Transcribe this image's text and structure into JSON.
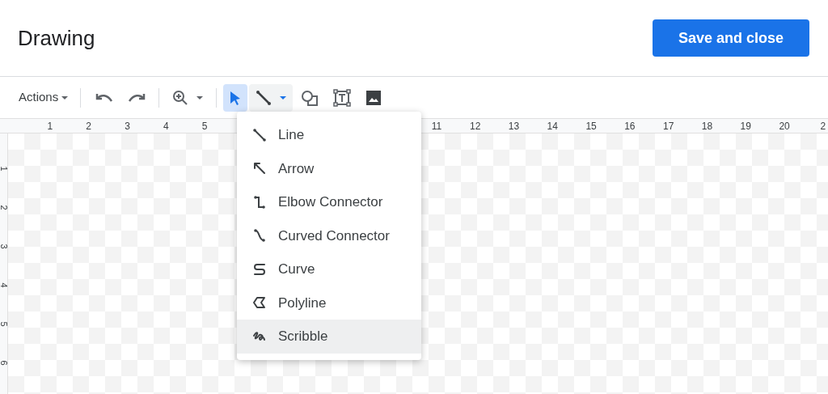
{
  "header": {
    "title": "Drawing",
    "save_button": "Save and close"
  },
  "toolbar": {
    "actions_menu": "Actions",
    "tools": [
      {
        "kind": "undo",
        "selected": false
      },
      {
        "kind": "redo",
        "selected": false
      },
      {
        "kind": "zoom",
        "selected": false
      },
      {
        "kind": "select",
        "selected": true
      },
      {
        "kind": "line",
        "selected": false,
        "expanded": true
      },
      {
        "kind": "shape",
        "selected": false
      },
      {
        "kind": "textbox",
        "selected": false
      },
      {
        "kind": "image",
        "selected": false
      }
    ]
  },
  "ruler": {
    "left_labels": [
      "1",
      "2",
      "3",
      "4",
      "5"
    ],
    "right_labels": [
      "11",
      "12",
      "13",
      "14",
      "15",
      "16",
      "17",
      "18",
      "19",
      "20",
      "2"
    ],
    "vertical_labels": [
      "1",
      "2",
      "3",
      "4",
      "5",
      "6"
    ]
  },
  "line_menu": {
    "items": [
      {
        "kind": "line",
        "label": "Line",
        "selected": false
      },
      {
        "kind": "arrow",
        "label": "Arrow",
        "selected": false
      },
      {
        "kind": "elbow",
        "label": "Elbow Connector",
        "selected": false
      },
      {
        "kind": "curved",
        "label": "Curved Connector",
        "selected": false
      },
      {
        "kind": "curve",
        "label": "Curve",
        "selected": false
      },
      {
        "kind": "polyline",
        "label": "Polyline",
        "selected": false
      },
      {
        "kind": "scribble",
        "label": "Scribble",
        "selected": true
      }
    ]
  }
}
